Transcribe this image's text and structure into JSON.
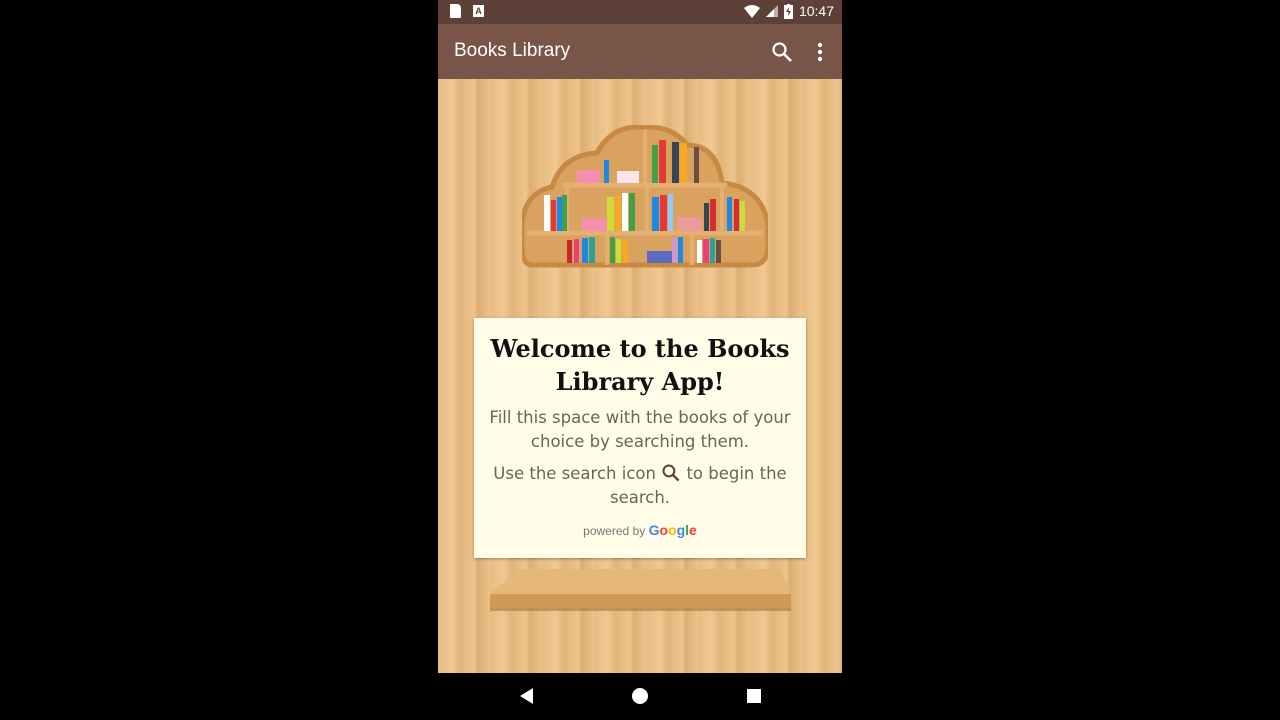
{
  "status_bar": {
    "left_icons": [
      "sd-card-icon",
      "text-a-icon"
    ],
    "right_icons": [
      "wifi-icon",
      "cell-signal-icon",
      "battery-charging-icon"
    ],
    "time": "10:47"
  },
  "app_bar": {
    "title": "Books Library",
    "actions": [
      "search-icon",
      "more-vert-icon"
    ],
    "color": "#795548",
    "status_color": "#5d4037"
  },
  "welcome_card": {
    "title": "Welcome to the Books Library App!",
    "text1": "Fill this space with the books of your choice by searching them.",
    "text2_before": "Use the search icon",
    "text2_after": "to begin the search.",
    "powered_by": "powered by",
    "google_letters": [
      {
        "ch": "G",
        "color": "#4285f4"
      },
      {
        "ch": "o",
        "color": "#ea4335"
      },
      {
        "ch": "o",
        "color": "#fbbc05"
      },
      {
        "ch": "g",
        "color": "#4285f4"
      },
      {
        "ch": "l",
        "color": "#34a853"
      },
      {
        "ch": "e",
        "color": "#ea4335"
      }
    ],
    "background": "#fffde7"
  },
  "nav_bar": {
    "buttons": [
      "back",
      "home",
      "recents"
    ]
  }
}
